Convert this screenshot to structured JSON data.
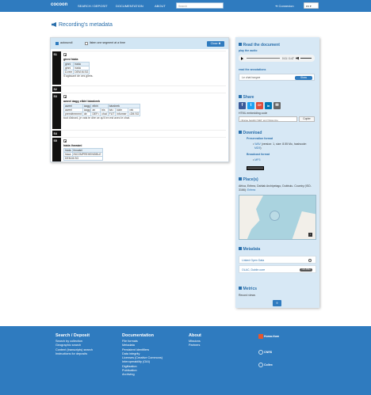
{
  "nav": {
    "brand": "cocoon",
    "items": [
      "SEARCH / DEPOSIT",
      "DOCUMENTATION",
      "ABOUT"
    ],
    "search_placeholder": "Search",
    "login": "Connexion",
    "lang": "en"
  },
  "page": {
    "title": "Recording's metadata"
  },
  "transcript": {
    "autoscroll_label": "autoscroll",
    "listen_label": "listen one segment at a time",
    "close_label": "Close",
    "segments": [
      {
        "id": "S1",
        "form": "ginni hàda",
        "words": [
          "ginni",
          "hàda"
        ],
        "morphs": [
          "ginni",
          "hàda"
        ],
        "glosses": [
          "D.rem",
          "DEM.M.SG"
        ],
        "translation": "S'agissant de ces gilets."
      },
      {
        "id": "S2"
      },
      {
        "id": "S3",
        "form": "aweei àagg elbiri bàrabrek",
        "words": [
          "aweei",
          "àagg",
          "elbiri",
          "bàrabrek"
        ],
        "morphs": [
          "aweei",
          "àagg",
          "an",
          "bis",
          "bà=",
          "kàbr",
          "=ek"
        ],
        "glosses": [
          "premièrement",
          "de",
          "DEF=",
          "chat",
          "FUT",
          "informer",
          "=2M.SG"
        ],
        "translation": "tout d'abord, je vais te dire ce qu'il en est avec le chat."
      },
      {
        "id": "S4"
      },
      {
        "id": "S5",
        "form": "hàda ihnwàni",
        "words": [
          "hàda",
          "ihnwàni"
        ],
        "morphs": [
          "hàca",
          "INCOMPREHENSIBLE"
        ],
        "glosses": [
          "DEM.M.SG"
        ]
      }
    ]
  },
  "sidebar": {
    "read_title": "Read the document",
    "play_audio": "play the audio",
    "audio_time": "0:11 / 1:47",
    "read_annotations": "read the annotations",
    "annotation_file": "Le chat borgne",
    "show_label": "Show",
    "share_title": "Share",
    "share_buttons": [
      {
        "label": "f",
        "color": "#3b5998"
      },
      {
        "label": "t",
        "color": "#1da1f2"
      },
      {
        "label": "G+",
        "color": "#dd4b39"
      },
      {
        "label": "in",
        "color": "#0077b5"
      },
      {
        "label": "✉",
        "color": "#666666"
      }
    ],
    "embed_label": "HTML embedding code",
    "embed_code": "<iframe height=\"320\" src=\"https://co",
    "copy_label": "Copier",
    "download_title": "Download",
    "preservation_label": "Preservation format",
    "wav_link": "WAV",
    "wav_detail": "(version: 1, size: 8.55 Mo, hashcode:",
    "md5_link": "MD5",
    "broadcast_label": "Broadcast format",
    "mp3_link": "MP3",
    "place_title": "Place(s)",
    "place_text": "Africa, Eritrea, Dahlak Archipelago, Dubbulu. Country (ISO-3166):",
    "country_link": "Eritrea",
    "metadata_title": "Metadata",
    "metadata_items": [
      "Linked Open Data",
      "OLAC, Dublin core"
    ],
    "oai_badge": "OAI-PMH",
    "metrics_title": "Metrics",
    "record_views": "Record views",
    "views_count": "9"
  },
  "footer": {
    "col1": {
      "title": "Search / Deposit",
      "links": [
        "Search by collection",
        "Geographic search",
        "Content (transcripts) search",
        "Instructions for deposits"
      ]
    },
    "col2": {
      "title": "Documentation",
      "links": [
        "File formats",
        "Metadata",
        "Persistent identifiers",
        "Data integrity",
        "Licenses (Creative Commons)",
        "Interoperability (OAI)",
        "Digitization",
        "Publication",
        "Archiving"
      ]
    },
    "col3": {
      "title": "About",
      "links": [
        "Missions",
        "Partners"
      ]
    },
    "partners": [
      "Huma-Num",
      "CNRS",
      "Collex"
    ]
  }
}
